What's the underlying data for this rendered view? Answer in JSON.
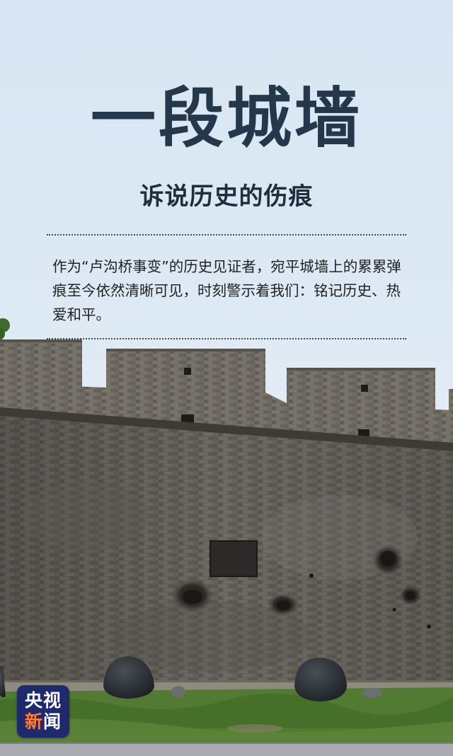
{
  "poster": {
    "title": "一段城墙",
    "subtitle": "诉说历史的伤痕",
    "body": "作为“卢沟桥事变”的历史见证者，宛平城墙上的累累弹痕至今依然清晰可见，时刻警示着我们：铭记历史、热爱和平。"
  },
  "logo": {
    "line1": "央视",
    "line2_part1": "新",
    "line2_part2": "闻",
    "bg_color": "#1e2a6b",
    "accent_color": "#ff7a3a"
  },
  "colors": {
    "sky": "#dbe8f4",
    "title": "#25374a",
    "wall": "#6a665f",
    "grass": "#4f7a32"
  }
}
